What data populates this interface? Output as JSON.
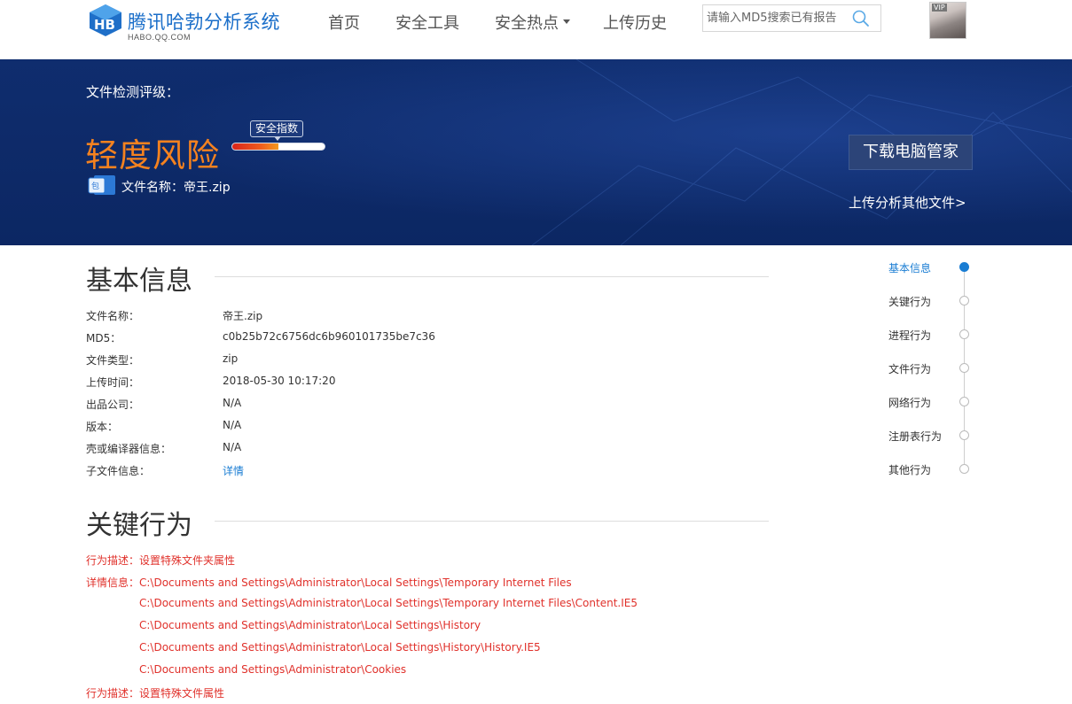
{
  "header": {
    "logo_title": "腾讯哈勃分析系统",
    "logo_subtitle": "HABO.QQ.COM",
    "nav": [
      {
        "label": "首页"
      },
      {
        "label": "安全工具"
      },
      {
        "label": "安全热点",
        "has_dropdown": true
      },
      {
        "label": "上传历史"
      }
    ],
    "search": {
      "placeholder": "请输入MD5搜索已有报告",
      "value": "",
      "icon": "search-icon"
    },
    "avatar": {
      "badge": "VIP",
      "icon": "user-avatar"
    }
  },
  "banner": {
    "rating_label": "文件检测评级：",
    "risk_level": "轻度风险",
    "score_tag": "安全指数",
    "score_fraction": 0.5,
    "file_name_label": "文件名称：",
    "file_name": "帝王.zip",
    "download_button": "下载电脑管家",
    "upload_link": "上传分析其他文件>",
    "colors": {
      "background": "#0f2d6e",
      "risk": "#f5821f"
    }
  },
  "basic_info": {
    "title": "基本信息",
    "rows": [
      {
        "key": "文件名称：",
        "value": "帝王.zip"
      },
      {
        "key": "MD5：",
        "value": "c0b25b72c6756dc6b960101735be7c36"
      },
      {
        "key": "文件类型：",
        "value": "zip"
      },
      {
        "key": "上传时间：",
        "value": "2018-05-30 10:17:20"
      },
      {
        "key": "出品公司：",
        "value": "N/A"
      },
      {
        "key": "版本：",
        "value": "N/A"
      },
      {
        "key": "壳或编译器信息：",
        "value": "N/A"
      },
      {
        "key": "子文件信息：",
        "value": "详情",
        "link": true
      }
    ]
  },
  "key_behavior": {
    "title": "关键行为",
    "lines": [
      "行为描述：设置特殊文件夹属性",
      "详情信息：C:\\Documents and Settings\\Administrator\\Local Settings\\Temporary Internet Files",
      "C:\\Documents and Settings\\Administrator\\Local Settings\\Temporary Internet Files\\Content.IE5",
      "C:\\Documents and Settings\\Administrator\\Local Settings\\History",
      "C:\\Documents and Settings\\Administrator\\Local Settings\\History\\History.IE5",
      "C:\\Documents and Settings\\Administrator\\Cookies",
      "行为描述：设置特殊文件属性"
    ],
    "color": "#e0312b"
  },
  "side_nav": {
    "items": [
      {
        "label": "基本信息",
        "active": true
      },
      {
        "label": "关键行为"
      },
      {
        "label": "进程行为"
      },
      {
        "label": "文件行为"
      },
      {
        "label": "网络行为"
      },
      {
        "label": "注册表行为"
      },
      {
        "label": "其他行为"
      }
    ],
    "accent": "#1a7dd3"
  }
}
